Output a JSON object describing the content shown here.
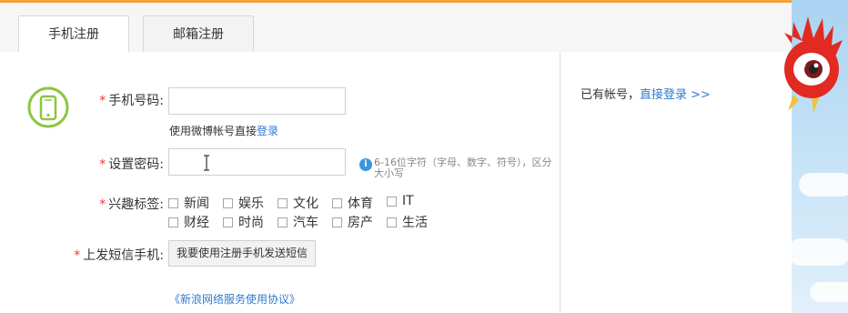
{
  "tabs": [
    {
      "label": "手机注册",
      "active": true
    },
    {
      "label": "邮箱注册",
      "active": false
    }
  ],
  "form": {
    "phone_label": "手机号码:",
    "phone_value": "",
    "weibo_hint_prefix": "使用微博帐号直接",
    "weibo_hint_link": "登录",
    "password_label": "设置密码:",
    "password_value": "",
    "password_tip": "6-16位字符（字母、数字、符号），区分大小写",
    "interest_label": "兴趣标签:",
    "interests": [
      "新闻",
      "娱乐",
      "文化",
      "体育",
      "IT",
      "财经",
      "时尚",
      "汽车",
      "房产",
      "生活"
    ],
    "sms_label": "上发短信手机:",
    "sms_button": "我要使用注册手机发送短信",
    "agreement": "《新浪网络服务使用协议》",
    "required_mark": "*"
  },
  "side": {
    "has_account": "已有帐号，",
    "login_link": "直接登录 >>"
  },
  "colors": {
    "accent_orange": "#f3a13a",
    "link_blue": "#2f7bd1",
    "required_red": "#e4393c",
    "phone_icon_green": "#8cc63f"
  },
  "icons": {
    "phone": "mobile-phone-icon",
    "tip": "info-icon",
    "mascot": "weibo-eye-mascot"
  }
}
